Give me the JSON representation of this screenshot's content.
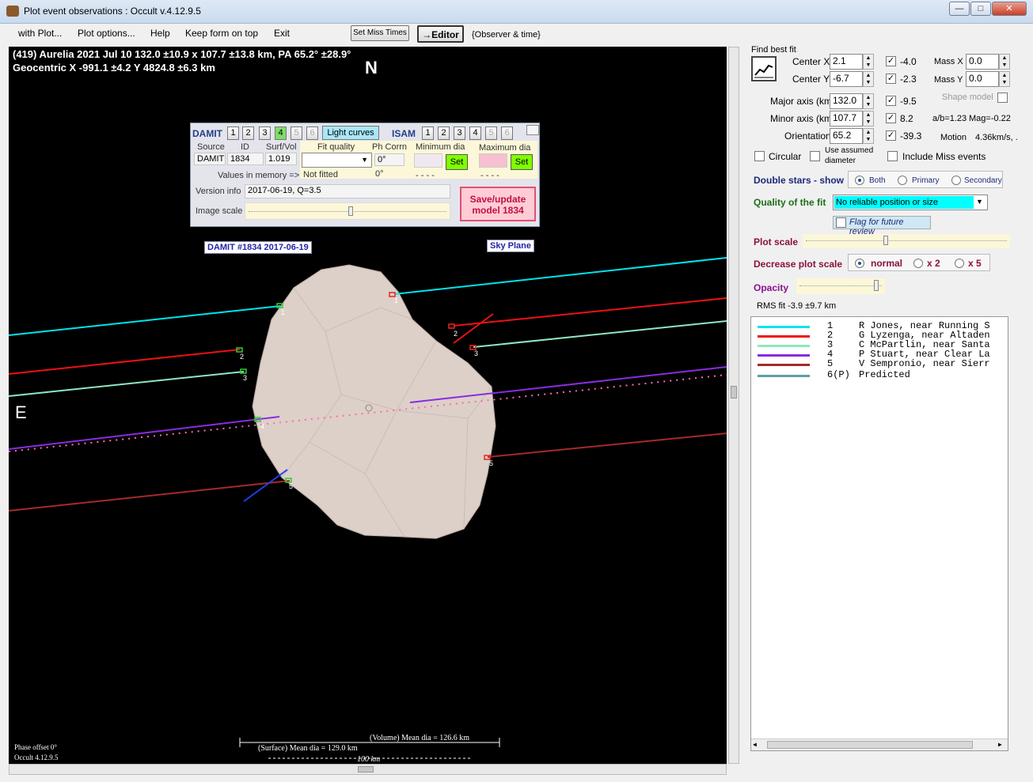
{
  "window": {
    "title": "Plot event observations : Occult v.4.12.9.5",
    "minimize": "—",
    "maximize": "□",
    "close": "✕"
  },
  "menu": {
    "items": [
      "with Plot...",
      "Plot options...",
      "Help",
      "Keep form on top",
      "Exit"
    ],
    "set_miss_times": "Set Miss Times",
    "editor": "→Editor",
    "observer_time": "{Observer & time}"
  },
  "plot": {
    "header_line1": "(419) Aurelia  2021 Jul 10   132.0 ±10.9 x 107.7 ±13.8 km,  PA 65.2° ±28.9°",
    "header_line2": "Geocentric  X  -991.1 ±4.2  Y 4824.8 ±6.3 km",
    "north": "N",
    "east": "E",
    "damit_label": "DAMIT #1834 2017-06-19",
    "sky_plane": "Sky Plane",
    "phase_offset": "Phase offset 0°",
    "version": "Occult 4.12.9.5",
    "volume_dia": "(Volume) Mean dia = 126.6 km",
    "surface_dia": "(Surface) Mean dia = 129.0 km",
    "scale_bar": "100 km",
    "chord_labels": [
      "1",
      "1",
      "2",
      "2",
      "3",
      "3",
      "4",
      "5",
      "5"
    ]
  },
  "damit_panel": {
    "damit": "DAMIT",
    "damit_nums": [
      "1",
      "2",
      "3",
      "4",
      "5",
      "6"
    ],
    "light_curves": "Light curves",
    "isam": "ISAM",
    "isam_nums": [
      "1",
      "2",
      "3",
      "4",
      "5",
      "6"
    ],
    "col_source": "Source",
    "col_id": "ID",
    "col_surfvol": "Surf/Vol",
    "source": "DAMIT",
    "id": "1834",
    "surfvol": "1.019",
    "values_in_memory": "Values in memory =>",
    "fit_quality": "Fit quality",
    "ph_corrn": "Ph Corrn",
    "min_dia": "Minimum dia",
    "max_dia": "Maximum dia",
    "ph_corrn_val": "0°",
    "ph_corrn_mem": "0°",
    "not_fitted": "Not fitted",
    "dashes1": "- - - -",
    "dashes2": "- - - -",
    "set": "Set",
    "version_info_label": "Version info",
    "version_info": "2017-06-19, Q=3.5",
    "image_scale": "Image scale",
    "save_update": "Save/update",
    "model": "model  1834"
  },
  "right": {
    "find_best_fit": "Find best fit",
    "center_x_label": "Center X",
    "center_x": "2.1",
    "center_x_resid": "-4.0",
    "center_y_label": "Center Y",
    "center_y": "-6.7",
    "center_y_resid": "-2.3",
    "mass_x_label": "Mass X",
    "mass_x": "0.0",
    "mass_y_label": "Mass Y",
    "mass_y": "0.0",
    "major_label": "Major axis (km)",
    "major": "132.0",
    "major_resid": "-9.5",
    "minor_label": "Minor axis (km)",
    "minor": "107.7",
    "minor_resid": "8.2",
    "orient_label": "Orientation",
    "orient": "65.2",
    "orient_resid": "-39.3",
    "shape_model": "Shape model",
    "ab": "a/b=1.23",
    "mag": "Mag=-0.22",
    "motion_label": "Motion",
    "motion": "4.36km/s, .",
    "circular": "Circular",
    "use_assumed": "Use assumed",
    "diameter": "diameter",
    "include_miss": "Include Miss events",
    "double_stars": "Double stars - show",
    "both": "Both",
    "primary": "Primary",
    "secondary": "Secondary",
    "quality_label": "Quality of the fit",
    "quality_value": "No reliable position or size",
    "flag_review": "Flag for future review",
    "plot_scale": "Plot scale",
    "decrease": "Decrease plot scale",
    "normal": "normal",
    "x2": "x 2",
    "x5": "x 5",
    "opacity": "Opacity",
    "rms": "RMS fit  -3.9 ±9.7 km"
  },
  "legend": [
    {
      "num": "1",
      "name": "R Jones, near Running S",
      "color": "#00e5ee"
    },
    {
      "num": "2",
      "name": "G Lyzenga, near Altaden",
      "color": "#ee1111"
    },
    {
      "num": "3",
      "name": "C McPartlin, near Santa",
      "color": "#8fe8c0"
    },
    {
      "num": "4",
      "name": "P Stuart, near Clear La",
      "color": "#8a2be2"
    },
    {
      "num": "5",
      "name": "V Sempronio, near Sierr",
      "color": "#a52a2a"
    },
    {
      "num": "6(P)",
      "name": "Predicted",
      "color": "#5f9ea0"
    }
  ]
}
